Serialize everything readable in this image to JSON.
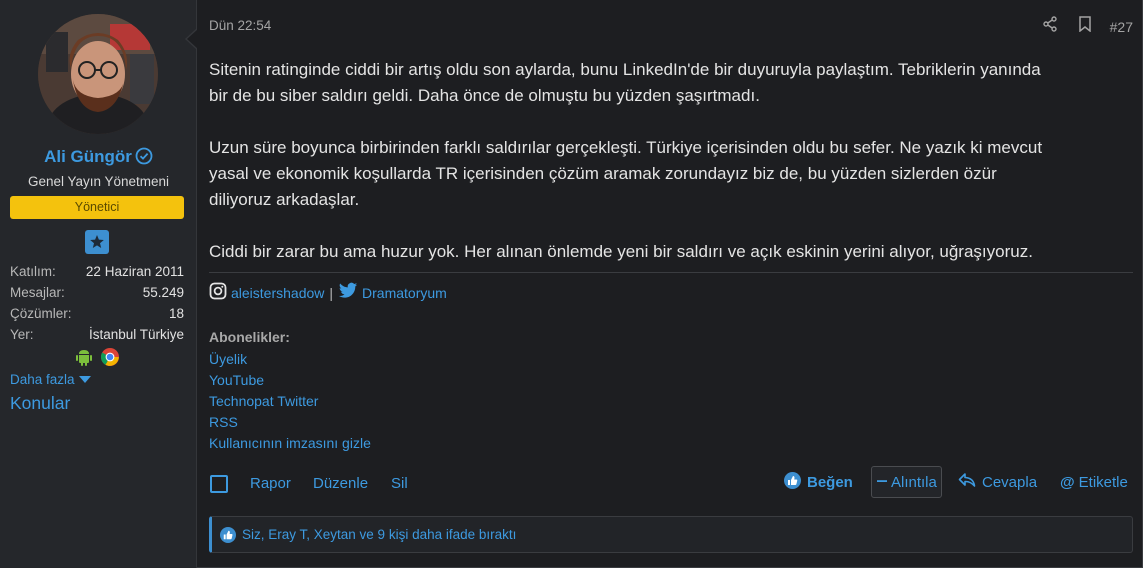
{
  "user": {
    "name": "Ali Güngör",
    "title": "Genel Yayın Yönetmeni",
    "role": "Yönetici",
    "stats": [
      {
        "label": "Katılım:",
        "value": "22 Haziran 2011"
      },
      {
        "label": "Mesajlar:",
        "value": "55.249"
      },
      {
        "label": "Çözümler:",
        "value": "18"
      },
      {
        "label": "Yer:",
        "value": "İstanbul Türkiye"
      }
    ],
    "more_label": "Daha fazla",
    "topics_label": "Konular"
  },
  "post": {
    "time": "Dün 22:54",
    "number": "#27",
    "paragraphs": [
      "Sitenin ratinginde ciddi bir artış oldu son aylarda, bunu LinkedIn'de bir duyuruyla paylaştım. Tebriklerin yanında",
      "bir de bu siber saldırı geldi. Daha önce de olmuştu bu yüzden şaşırtmadı.",
      "Uzun süre boyunca birbirinden farklı saldırılar gerçekleşti. Türkiye içerisinden oldu bu sefer. Ne yazık ki mevcut",
      "yasal ve ekonomik koşullarda TR içerisinden çözüm aramak zorundayız biz de, bu yüzden sizlerden özür",
      "diliyoruz arkadaşlar.",
      "Ciddi bir zarar bu ama huzur yok. Her alınan önlemde yeni bir saldırı ve açık eskinin yerini alıyor, uğraşıyoruz."
    ]
  },
  "signature": {
    "instagram": "aleistershadow",
    "separator": "|",
    "twitter": "Dramatoryum"
  },
  "subscriptions": {
    "heading": "Abonelikler:",
    "items": [
      "Üyelik",
      "YouTube",
      "Technopat Twitter",
      "RSS",
      "Kullanıcının imzasını gizle"
    ]
  },
  "actions": {
    "report": "Rapor",
    "edit": "Düzenle",
    "delete": "Sil",
    "like": "Beğen",
    "quote": "Alıntıla",
    "reply": "Cevapla",
    "tag": "Etiketle"
  },
  "reactions": {
    "text": "Siz, Eray T, Xeytan ve 9 kişi daha ifade bıraktı"
  },
  "colors": {
    "accent": "#3d9ae0",
    "badge": "#f4c20d",
    "background": "#1d1e21",
    "sidebar": "#25272b"
  },
  "icons": [
    "verified-icon",
    "star-badge-icon",
    "android-icon",
    "chrome-icon",
    "share-icon",
    "bookmark-icon",
    "instagram-icon",
    "twitter-icon",
    "like-icon",
    "quote-icon",
    "reply-icon",
    "at-icon"
  ]
}
